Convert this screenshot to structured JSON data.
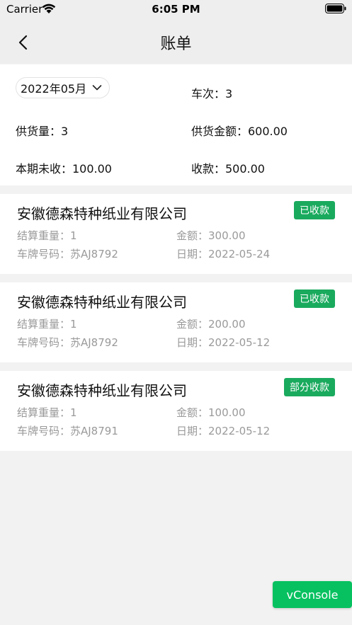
{
  "status_bar": {
    "carrier": "Carrier",
    "time": "6:05 PM"
  },
  "nav": {
    "title": "账单"
  },
  "summary": {
    "month": "2022年05月",
    "trips": "车次：3",
    "supply_qty": "供货量：3",
    "supply_amount": "供货金额：600.00",
    "unpaid": "本期未收：100.00",
    "received": "收款：500.00"
  },
  "bills": [
    {
      "company": "安徽德森特种纸业有限公司",
      "status": "已收款",
      "weight": "结算重量：1",
      "amount": "金额：300.00",
      "plate": "车牌号码：苏AJ8792",
      "date": "日期：2022-05-24"
    },
    {
      "company": "安徽德森特种纸业有限公司",
      "status": "已收款",
      "weight": "结算重量：1",
      "amount": "金额：200.00",
      "plate": "车牌号码：苏AJ8792",
      "date": "日期：2022-05-12"
    },
    {
      "company": "安徽德森特种纸业有限公司",
      "status": "部分收款",
      "weight": "结算重量：1",
      "amount": "金额：100.00",
      "plate": "车牌号码：苏AJ8791",
      "date": "日期：2022-05-12"
    }
  ],
  "vconsole": {
    "label": "vConsole"
  },
  "colors": {
    "badge_green": "#1aaa5e",
    "vconsole_green": "#07c160",
    "background": "#f2f2f2"
  }
}
